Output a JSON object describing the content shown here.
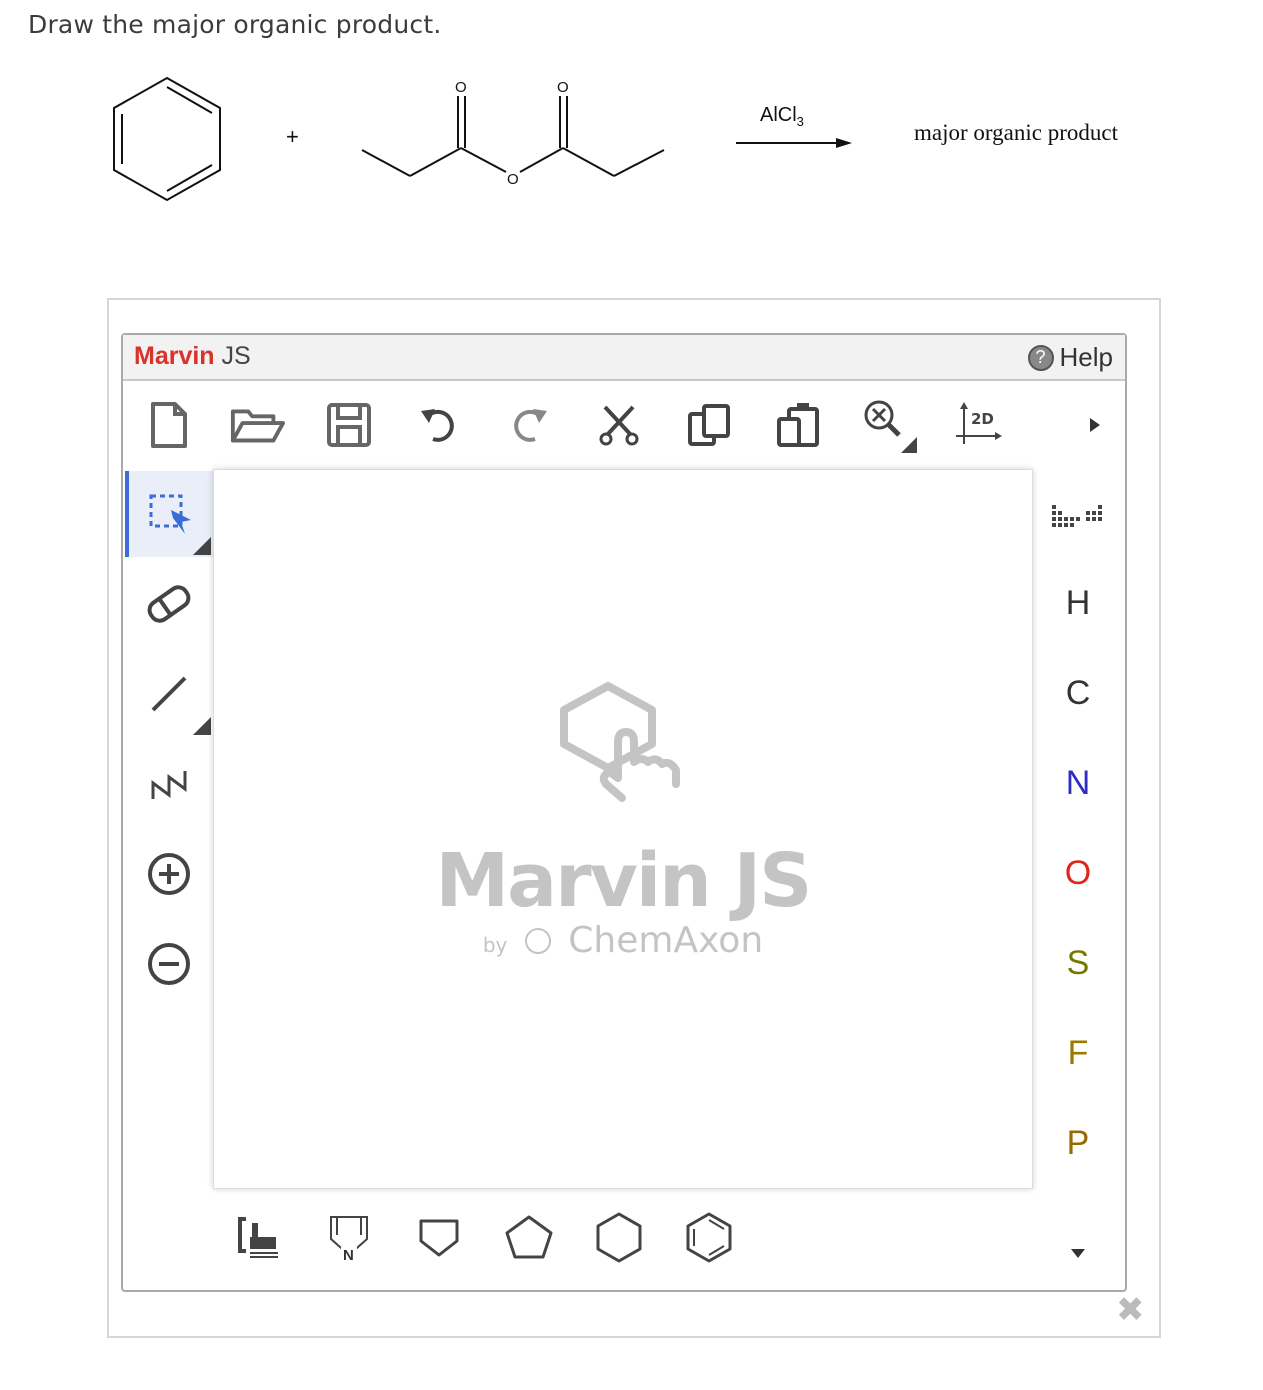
{
  "question": {
    "prompt": "Draw the major organic product."
  },
  "reaction": {
    "plus": "+",
    "reagent": "AlCl",
    "reagent_subscript": "3",
    "product_label": "major organic product",
    "atom_labels": [
      "O",
      "O",
      "O"
    ]
  },
  "editor": {
    "brand_name": "Marvin",
    "brand_suffix": "JS",
    "help_label": "Help",
    "help_icon": "?",
    "watermark_title": "Marvin JS",
    "watermark_by": "by",
    "watermark_company": "ChemAxon",
    "brand_color": "#d8322a",
    "accent_color": "#3b6cd8",
    "twod_label": "2D",
    "toolbar": [
      {
        "name": "new-document-icon"
      },
      {
        "name": "open-folder-icon"
      },
      {
        "name": "save-icon"
      },
      {
        "name": "undo-icon"
      },
      {
        "name": "redo-icon"
      },
      {
        "name": "cut-icon"
      },
      {
        "name": "copy-icon"
      },
      {
        "name": "paste-icon"
      },
      {
        "name": "zoom-icon"
      },
      {
        "name": "clean-2d-icon"
      },
      {
        "name": "more-arrow-icon"
      }
    ],
    "left_tools": [
      {
        "name": "select-icon",
        "active": true
      },
      {
        "name": "erase-icon"
      },
      {
        "name": "single-bond-icon"
      },
      {
        "name": "chain-icon"
      },
      {
        "name": "increase-charge-icon"
      },
      {
        "name": "decrease-charge-icon"
      }
    ],
    "elements": [
      {
        "symbol": "H",
        "color": "#333333"
      },
      {
        "symbol": "C",
        "color": "#333333"
      },
      {
        "symbol": "N",
        "color": "#2d2dc8"
      },
      {
        "symbol": "O",
        "color": "#e2251b"
      },
      {
        "symbol": "S",
        "color": "#777700"
      },
      {
        "symbol": "F",
        "color": "#9a7a00"
      },
      {
        "symbol": "P",
        "color": "#9a6a00"
      }
    ],
    "bottom_templates": [
      {
        "name": "bracket-template-icon"
      },
      {
        "name": "pyrrolidine-template-icon",
        "label": "N"
      },
      {
        "name": "cyclopropane-template-icon"
      },
      {
        "name": "cyclopentane-template-icon"
      },
      {
        "name": "cyclohexane-template-icon"
      },
      {
        "name": "benzene-template-icon"
      }
    ],
    "close_icon": "✖"
  }
}
